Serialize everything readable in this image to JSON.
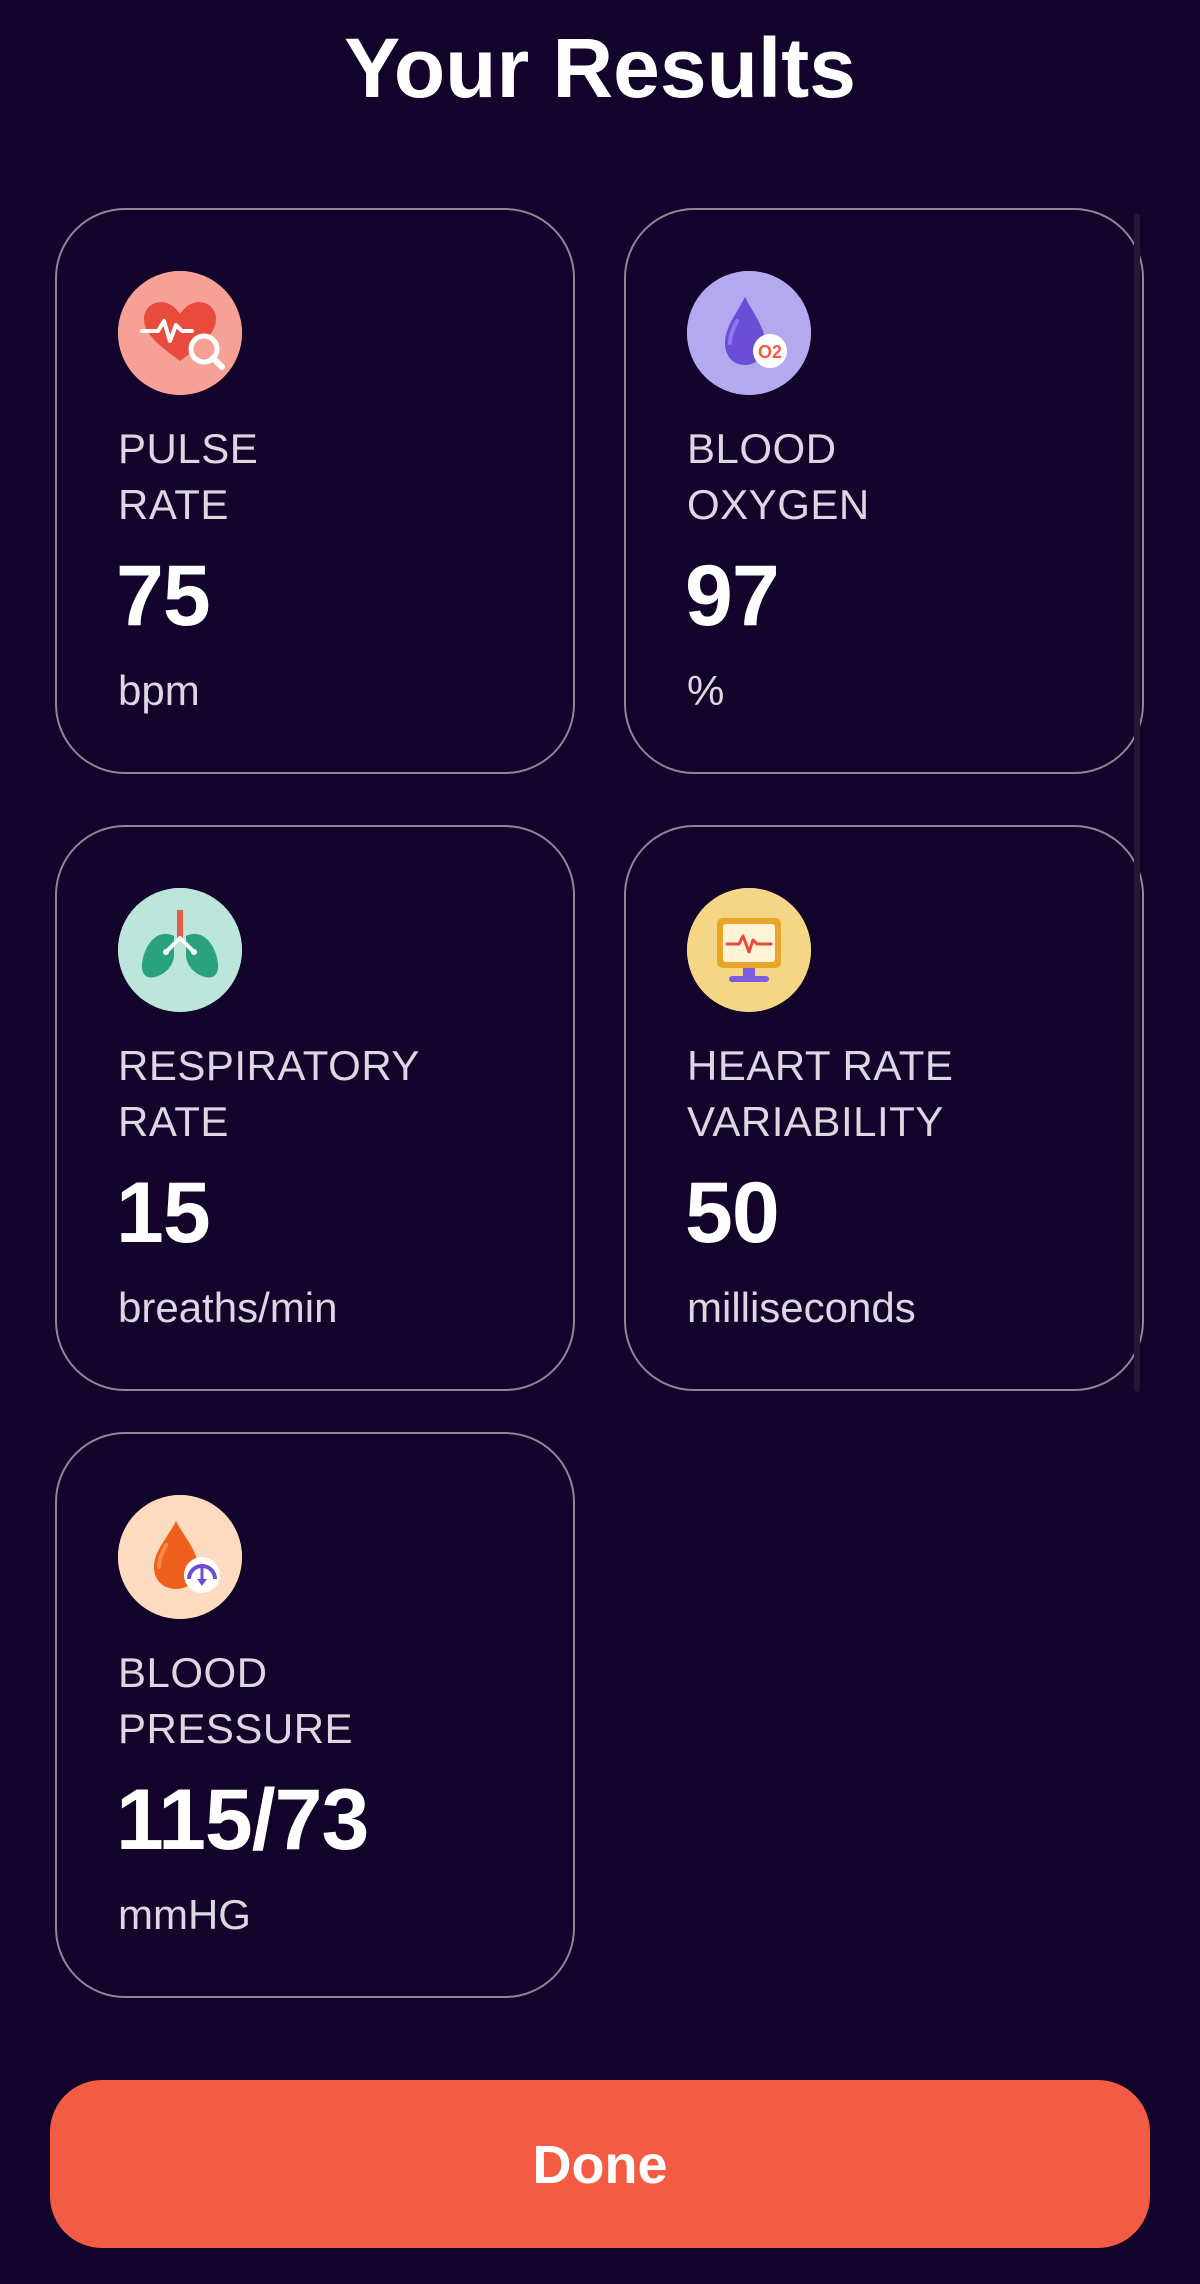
{
  "page": {
    "title": "Your Results"
  },
  "cards": [
    {
      "id": "pulse",
      "label_line1": "PULSE",
      "label_line2": "RATE",
      "value": "75",
      "unit": "bpm",
      "icon": "heart-pulse-icon",
      "icon_bg": "#F7A196"
    },
    {
      "id": "oxygen",
      "label_line1": "BLOOD",
      "label_line2": "OXYGEN",
      "value": "97",
      "unit": "%",
      "icon": "blood-oxygen-drop-icon",
      "icon_bg": "#B4A9EF"
    },
    {
      "id": "respiratory",
      "label_line1": "RESPIRATORY",
      "label_line2": "RATE",
      "value": "15",
      "unit": "breaths/min",
      "icon": "lungs-icon",
      "icon_bg": "#BCE6DA"
    },
    {
      "id": "hrv",
      "label_line1": "HEART RATE",
      "label_line2": "VARIABILITY",
      "value": "50",
      "unit": "milliseconds",
      "icon": "heart-monitor-icon",
      "icon_bg": "#F5D687"
    },
    {
      "id": "pressure",
      "label_line1": "BLOOD",
      "label_line2": "PRESSURE",
      "value": "115/73",
      "unit": "mmHG",
      "icon": "blood-pressure-drop-icon",
      "icon_bg": "#FDDBC0"
    }
  ],
  "actions": {
    "done_label": "Done"
  },
  "colors": {
    "background": "#12042A",
    "card_border": "#8E8696",
    "accent": "#F45B45"
  }
}
